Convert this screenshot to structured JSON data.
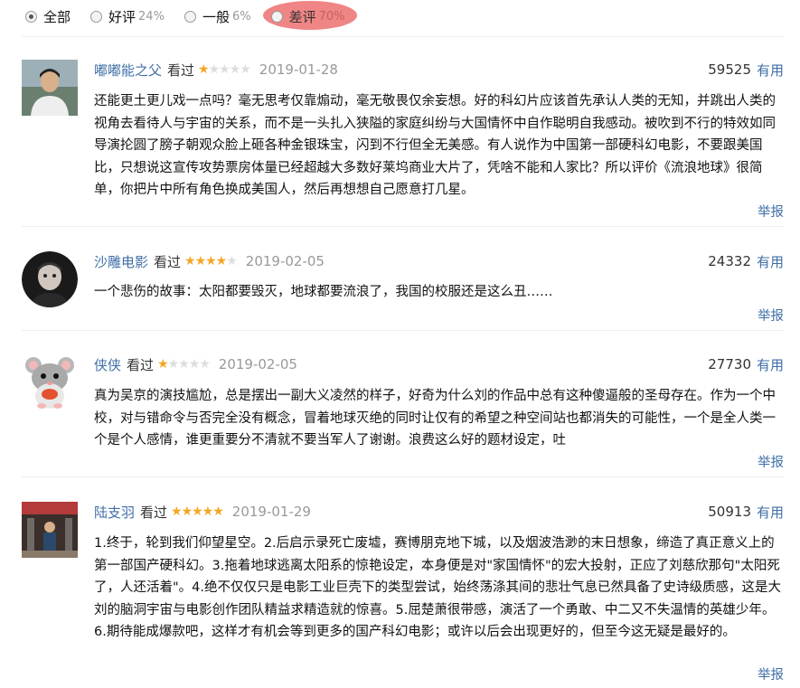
{
  "filters": [
    {
      "label": "全部",
      "pct": "",
      "checked": true
    },
    {
      "label": "好评",
      "pct": "24%",
      "checked": false
    },
    {
      "label": "一般",
      "pct": "6%",
      "checked": false
    },
    {
      "label": "差评",
      "pct": "70%",
      "checked": false
    }
  ],
  "seen_label": "看过",
  "useful_label": "有用",
  "report_label": "举报",
  "reviews": [
    {
      "user": "嘟嘟能之父",
      "rating": 1,
      "date": "2019-01-28",
      "votes": "59525",
      "text": "还能更土更儿戏一点吗？毫无思考仅靠煽动，毫无敬畏仅余妄想。好的科幻片应该首先承认人类的无知，并跳出人类的视角去看待人与宇宙的关系，而不是一头扎入狭隘的家庭纠纷与大国情怀中自作聪明自我感动。被吹到不行的特效如同导演抡圆了膀子朝观众脸上砸各种金银珠宝，闪到不行但全无美感。有人说作为中国第一部硬科幻电影，不要跟美国比，只想说这宣传攻势票房体量已经超越大多数好莱坞商业大片了，凭啥不能和人家比？所以评价《流浪地球》很简单，你把片中所有角色换成美国人，然后再想想自己愿意打几星。"
    },
    {
      "user": "沙雕电影",
      "rating": 4,
      "date": "2019-02-05",
      "votes": "24332",
      "text": "一个悲伤的故事：太阳都要毁灭，地球都要流浪了，我国的校服还是这么丑……"
    },
    {
      "user": "侠侠",
      "rating": 1,
      "date": "2019-02-05",
      "votes": "27730",
      "text": "真为吴京的演技尴尬，总是摆出一副大义凌然的样子，好奇为什么刘的作品中总有这种傻逼般的圣母存在。作为一个中校，对与错命令与否完全没有概念，冒着地球灭绝的同时让仅有的希望之种空间站也都消失的可能性，一个是全人类一个是个人感情，谁更重要分不清就不要当军人了谢谢。浪费这么好的题材设定，吐"
    },
    {
      "user": "陆支羽",
      "rating": 5,
      "date": "2019-01-29",
      "votes": "50913",
      "text": "1.终于，轮到我们仰望星空。2.后启示录死亡废墟，赛博朋克地下城，以及烟波浩渺的末日想象，缔造了真正意义上的第一部国产硬科幻。3.拖着地球逃离太阳系的惊艳设定，本身便是对\"家国情怀\"的宏大投射，正应了刘慈欣那句\"太阳死了，人还活着\"。4.绝不仅仅只是电影工业巨壳下的类型尝试，始终荡涤其间的悲壮气息已然具备了史诗级质感，这是大刘的脑洞宇宙与电影创作团队精益求精造就的惊喜。5.屈楚萧很带感，演活了一个勇敢、中二又不失温情的英雄少年。6.期待能成爆款吧，这样才有机会等到更多的国产科幻电影；或许以后会出现更好的，但至今这无疑是最好的。"
    }
  ],
  "colors": {
    "link": "#3f6fa6",
    "star": "#f5a623",
    "highlight": "#f08585"
  }
}
